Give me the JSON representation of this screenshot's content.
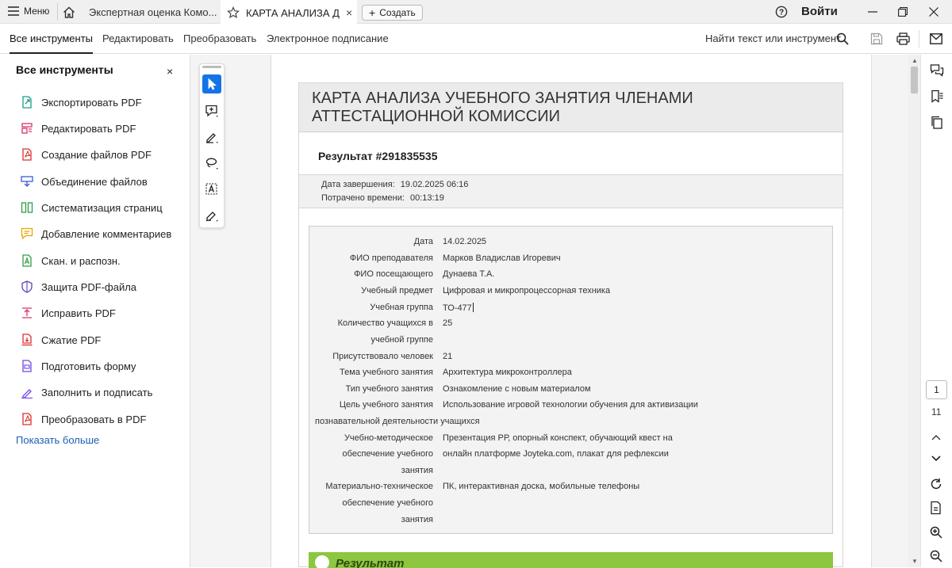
{
  "titlebar": {
    "menu_label": "Меню",
    "tabs": [
      {
        "label": "Экспертная оценка Комо..."
      },
      {
        "label": "КАРТА АНАЛИЗА Д..."
      }
    ],
    "new_tab_label": "Создать",
    "signin_label": "Войти"
  },
  "menubar": {
    "items": [
      "Все инструменты",
      "Редактировать",
      "Преобразовать",
      "Электронное подписание"
    ],
    "find_label": "Найти текст или инструмент"
  },
  "left_panel": {
    "title": "Все инструменты",
    "close_label": "×",
    "tools": [
      {
        "label": "Экспортировать PDF",
        "icon": "export-pdf-icon",
        "color": "#1a9c8a"
      },
      {
        "label": "Редактировать PDF",
        "icon": "edit-pdf-icon",
        "color": "#d6336c"
      },
      {
        "label": "Создание файлов PDF",
        "icon": "create-pdf-icon",
        "color": "#d9302b"
      },
      {
        "label": "Объединение файлов",
        "icon": "combine-files-icon",
        "color": "#3b5bdb"
      },
      {
        "label": "Систематизация страниц",
        "icon": "organize-pages-icon",
        "color": "#2f9e44"
      },
      {
        "label": "Добавление комментариев",
        "icon": "comment-icon",
        "color": "#e8a400"
      },
      {
        "label": "Скан. и распозн.",
        "icon": "scan-icon",
        "color": "#2f9e44"
      },
      {
        "label": "Защита PDF-файла",
        "icon": "protect-icon",
        "color": "#5f3dc4"
      },
      {
        "label": "Исправить PDF",
        "icon": "fix-pdf-icon",
        "color": "#d6336c"
      },
      {
        "label": "Сжатие PDF",
        "icon": "compress-pdf-icon",
        "color": "#d9302b"
      },
      {
        "label": "Подготовить форму",
        "icon": "prepare-form-icon",
        "color": "#7048e8"
      },
      {
        "label": "Заполнить и подписать",
        "icon": "fill-sign-icon",
        "color": "#7048e8"
      },
      {
        "label": "Преобразовать в PDF",
        "icon": "convert-pdf-icon",
        "color": "#d9302b"
      }
    ],
    "show_more": "Показать больше"
  },
  "document": {
    "title": "КАРТА АНАЛИЗА УЧЕБНОГО ЗАНЯТИЯ ЧЛЕНАМИ АТТЕСТАЦИОННОЙ КОМИССИИ",
    "result_title": "Результат #291835535",
    "completed_label": "Дата завершения:",
    "completed_value": "19.02.2025 06:16",
    "spent_label": "Потрачено времени:",
    "spent_value": "00:13:19",
    "fields": {
      "date_label": "Дата",
      "date_value": "14.02.2025",
      "teacher_label": "ФИО преподавателя",
      "teacher_value": "Марков Владислав Игоревич",
      "visitor_label": "ФИО посещающего",
      "visitor_value": "Дунаева Т.А.",
      "subject_label": "Учебный предмет",
      "subject_value": "Цифровая и микропроцессорная техника",
      "group_label": "Учебная группа",
      "group_value": "ТО-477",
      "count_label_1": "Количество учащихся в",
      "count_label_2": "учебной группе",
      "count_value": "25",
      "present_label": "Присутствовало человек",
      "present_value": "21",
      "topic_label": "Тема учебного занятия",
      "topic_value": "Архитектура микроконтроллера",
      "type_label": "Тип учебного занятия",
      "type_value": "Ознакомление с новым материалом",
      "goal_label": "Цель учебного занятия",
      "goal_value_1": "Использование игровой технологии обучения для активизации",
      "goal_value_2": "познавательной деятельности учащихся",
      "method_label_1": "Учебно-методическое",
      "method_label_2": "обеспечение учебного",
      "method_label_3": "занятия",
      "method_value_1": "Презентация РР, опорный конспект, обучающий квест на",
      "method_value_2": "онлайн платформе Joyteka.com, плакат для рефлексии",
      "tech_label_1": "Материально-техническое",
      "tech_label_2": "обеспечение учебного",
      "tech_label_3": "занятия",
      "tech_value": "ПК, интерактивная доска, мобильные телефоны"
    },
    "section_result": "Результат"
  },
  "pagination": {
    "current": "1",
    "total": "11"
  }
}
